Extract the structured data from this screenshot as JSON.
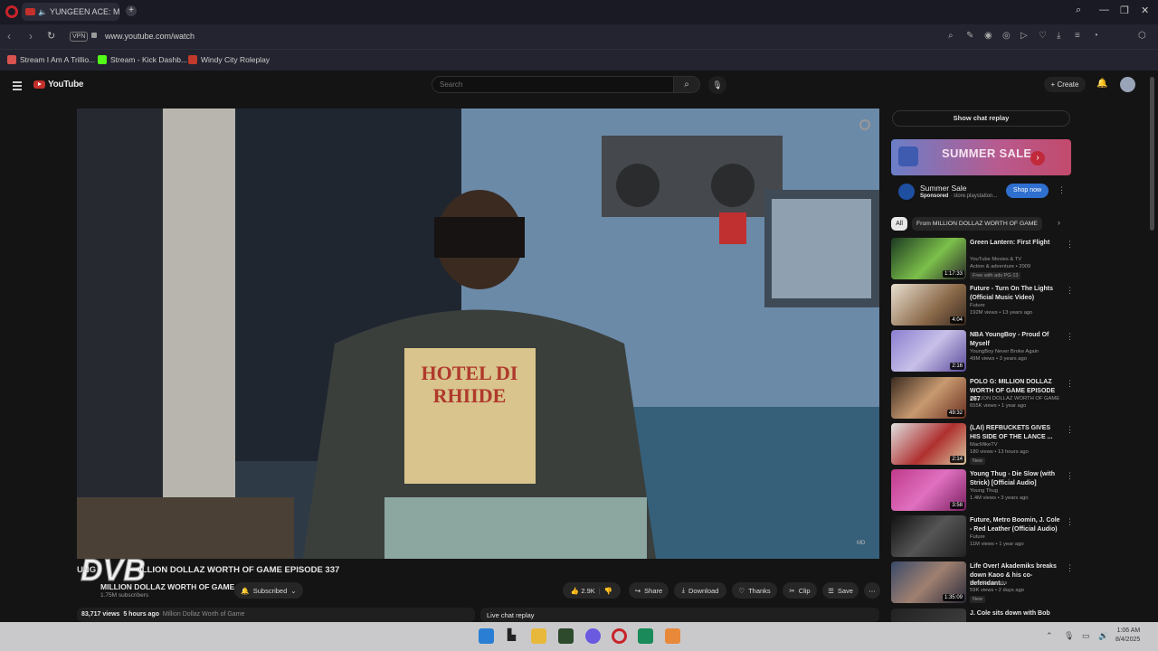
{
  "browser": {
    "tab_title": "YUNGEEN ACE: MILLI",
    "tab_close": "×",
    "url": "www.youtube.com/watch",
    "vpn_label": "VPN",
    "bookmarks": [
      {
        "label": "Stream I Am A Trillio...",
        "color": "#d9534f"
      },
      {
        "label": "Stream - Kick Dashb...",
        "color": "#53fc18"
      },
      {
        "label": "Windy City Roleplay",
        "color": "#c0392b"
      }
    ]
  },
  "youtube": {
    "logo_text": "YouTube",
    "search_placeholder": "Search",
    "create_label": "Create"
  },
  "video": {
    "title_prefix": "UNG",
    "title": "ILLION DOLLAZ WORTH OF GAME EPISODE 337",
    "channel_name": "MILLION DOLLAZ WORTH OF GAME",
    "subscribers": "1.75M subscribers",
    "subscribed_label": "Subscribed",
    "likes": "2.9K",
    "share_label": "Share",
    "download_label": "Download",
    "thanks_label": "Thanks",
    "clip_label": "Clip",
    "save_label": "Save",
    "views": "83,717 views",
    "age": "5 hours ago",
    "desc_tag": "Million Dollaz Worth of Game",
    "live_chat_label": "Live chat replay"
  },
  "sidebar": {
    "show_chat_replay": "Show chat replay",
    "ad": {
      "banner_text": "SUMMER SALE",
      "title": "Summer Sale",
      "sponsored": "Sponsored",
      "domain": "store.playstation...",
      "cta": "Shop now"
    },
    "chips": [
      "All",
      "From MILLION DOLLAZ WORTH OF GAME"
    ],
    "recommendations": [
      {
        "title": "Green Lantern: First Flight",
        "channel": "YouTube Movies & TV",
        "views": "Action & adventure • 2009",
        "badge": "Free with ads   PG-13",
        "duration": "1:17:33",
        "thumb": "linear-gradient(135deg,#1c3a22,#7cc04a 55%,#2a2a2a)"
      },
      {
        "title": "Future - Turn On The Lights (Official Music Video)",
        "channel": "Future",
        "views": "192M views • 13 years ago",
        "badge": "",
        "duration": "4:04",
        "thumb": "linear-gradient(135deg,#e8dfd0,#8b6a4a 60%,#3a2a20)"
      },
      {
        "title": "NBA YoungBoy - Proud Of Myself",
        "channel": "YoungBoy Never Broke Again",
        "views": "49M views • 3 years ago",
        "badge": "",
        "duration": "2:16",
        "thumb": "linear-gradient(135deg,#8a7fd0,#c8c0e8 50%,#5b4a9a)"
      },
      {
        "title": "POLO G: MILLION DOLLAZ WORTH OF GAME EPISODE 267",
        "channel": "MILLION DOLLAZ WORTH OF GAME",
        "views": "655K views • 1 year ago",
        "badge": "",
        "duration": "49:32",
        "thumb": "linear-gradient(135deg,#3a2a20,#c89a70 50%,#6a3020)"
      },
      {
        "title": "(LAI) REFBUCKETS GIVES HIS SIDE OF THE LANCE ...",
        "channel": "MacMikeTV",
        "views": "180 views • 13 hours ago",
        "badge": "New",
        "duration": "2:14",
        "thumb": "linear-gradient(135deg,#e0e0e0,#b03030 55%,#d8c8a0)"
      },
      {
        "title": "Young Thug - Die Slow (with Strick) [Official Audio]",
        "channel": "Young Thug",
        "views": "1.4M views • 3 years ago",
        "badge": "",
        "duration": "3:58",
        "thumb": "linear-gradient(135deg,#c03a8a,#e070c0 50%,#7a2060)"
      },
      {
        "title": "Future, Metro Boomin, J. Cole - Red Leather (Official Audio)",
        "channel": "Future",
        "views": "11M views • 1 year ago",
        "badge": "",
        "duration": "",
        "thumb": "linear-gradient(135deg,#111,#555 50%,#222)"
      },
      {
        "title": "Life Over! Akademiks breaks down Kaoo & his co-defendant...",
        "channel": "King Akademiks",
        "views": "59K views • 2 days ago",
        "badge": "New",
        "duration": "1:35:09",
        "thumb": "linear-gradient(135deg,#3a4a6a,#a08070 50%,#2a2a3a)"
      },
      {
        "title": "J. Cole sits down with Bob",
        "channel": "",
        "views": "",
        "badge": "",
        "duration": "",
        "thumb": "linear-gradient(135deg,#222,#444)"
      }
    ]
  },
  "taskbar": {
    "time": "1:06 AM",
    "date": "8/4/2025"
  }
}
